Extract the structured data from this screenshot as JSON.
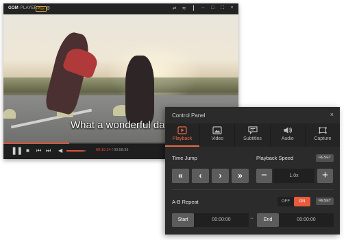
{
  "player": {
    "brand": "GOM",
    "brand_sub": "PLAYER",
    "plus_badge": "Plus",
    "subtitle": "What a wonderful da",
    "time_current": "00:16:14",
    "time_separator": " / ",
    "time_total": "00:58:39",
    "progress": 0.28,
    "volume": 0.9
  },
  "panel": {
    "title": "Control Panel",
    "tabs": [
      {
        "label": "Playback",
        "icon": "play-icon",
        "active": true
      },
      {
        "label": "Video",
        "icon": "image-icon",
        "active": false
      },
      {
        "label": "Subtitles",
        "icon": "speech-bubble-icon",
        "active": false
      },
      {
        "label": "Audio",
        "icon": "speaker-icon",
        "active": false
      },
      {
        "label": "Capture",
        "icon": "capture-icon",
        "active": false
      }
    ],
    "time_jump_label": "Time Jump",
    "playback_speed_label": "Playback Speed",
    "reset_label": "RESET",
    "speed_value": "1.0x",
    "ab_repeat_label": "A-B Repeat",
    "toggle_off": "OFF",
    "toggle_on": "ON",
    "start_label": "Start",
    "end_label": "End",
    "start_time": "00:00:00",
    "end_time": "00:00:00",
    "range_separator": "~"
  },
  "colors": {
    "accent": "#e86a47",
    "toggle_on": "#e85b3c",
    "panel_bg": "#2b2b2b",
    "button_bg": "#5c5c5c"
  }
}
